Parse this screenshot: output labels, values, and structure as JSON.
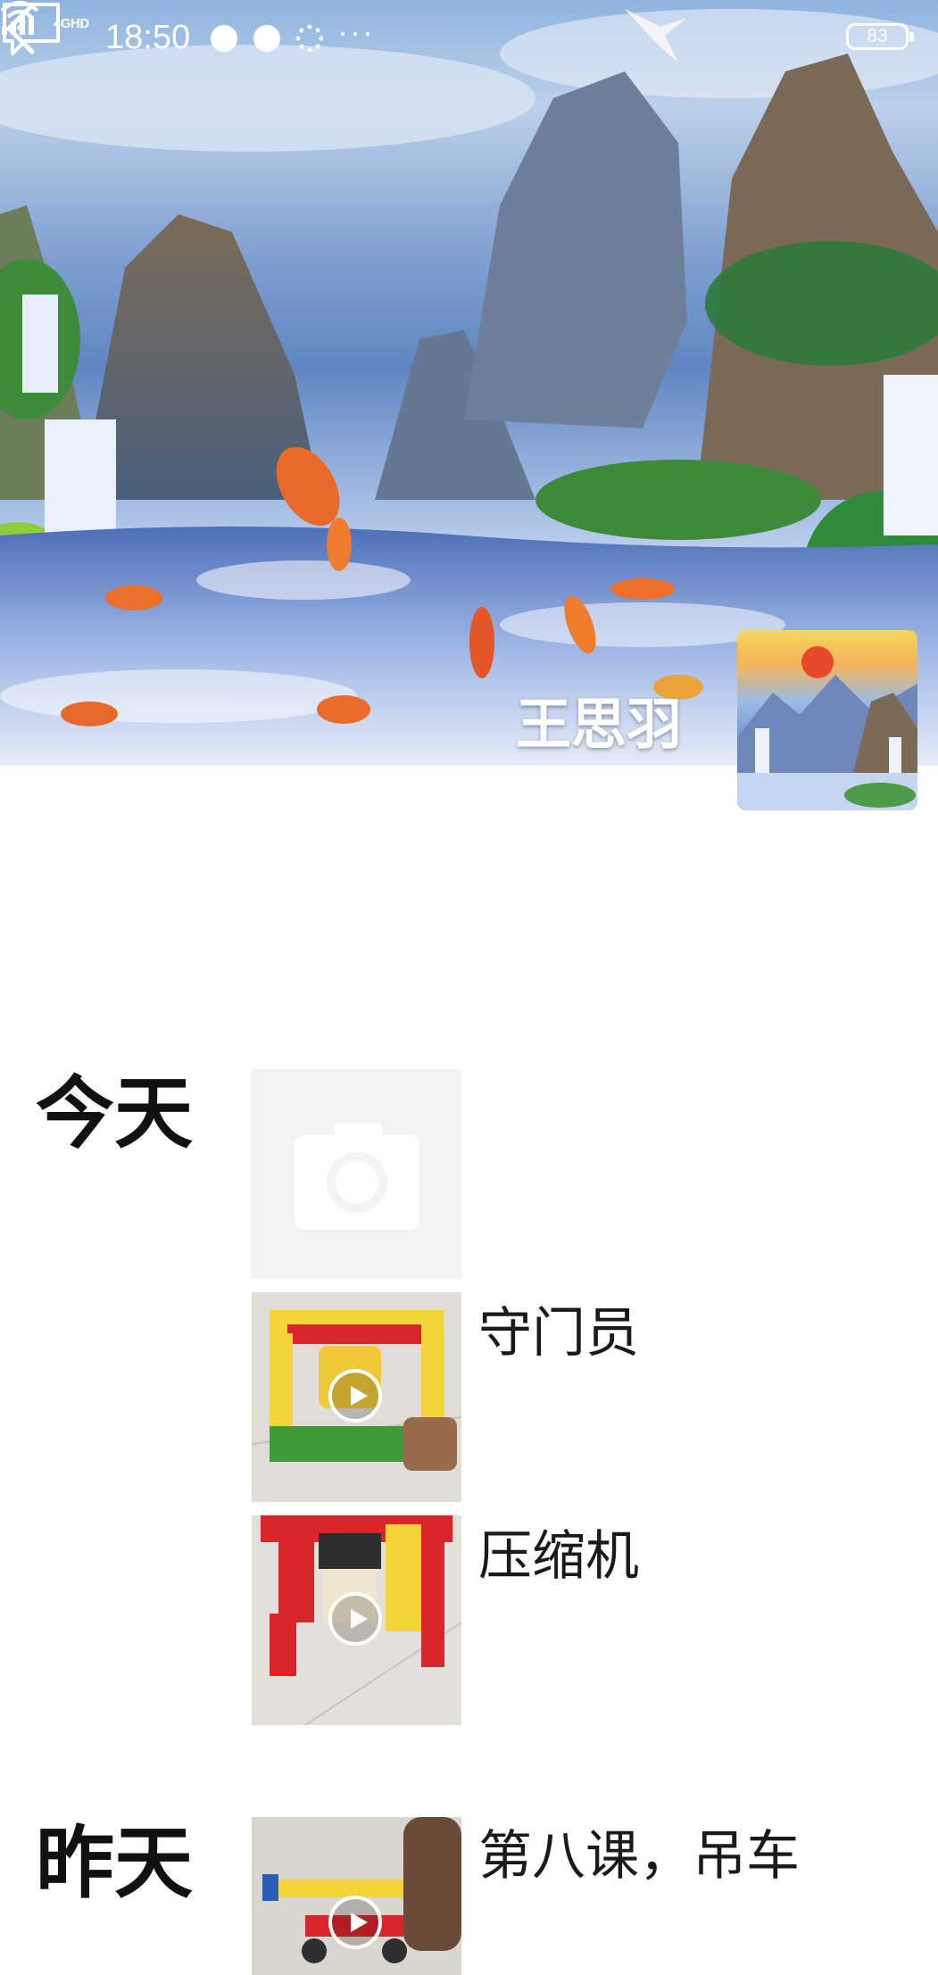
{
  "status_bar": {
    "network": "4GHD",
    "time": "18:50",
    "more": "···",
    "battery": "83"
  },
  "header": {
    "back_icon": "chevron-left-icon",
    "comment_icon": "comment-bubble-icon"
  },
  "profile": {
    "name": "王思羽",
    "cover": "landscape-painting-waterfalls-koi",
    "avatar": "landscape-painting-sunrise"
  },
  "timeline": [
    {
      "day": "今天",
      "posts": [
        {
          "type": "camera",
          "icon": "camera-icon",
          "title": ""
        },
        {
          "type": "video",
          "icon": "play-icon",
          "title": "守门员"
        },
        {
          "type": "video",
          "icon": "play-icon",
          "title": "压缩机"
        }
      ]
    },
    {
      "day": "昨天",
      "posts": [
        {
          "type": "video",
          "icon": "play-icon",
          "title": "第八课，吊车"
        }
      ]
    }
  ],
  "colors": {
    "page_bg": "#ffffff",
    "text": "#1a1a1a",
    "camera_placeholder_bg": "#f3f3f3",
    "lego_red": "#d8262b",
    "lego_yellow": "#f2d43a",
    "lego_green": "#3f9b3a"
  }
}
